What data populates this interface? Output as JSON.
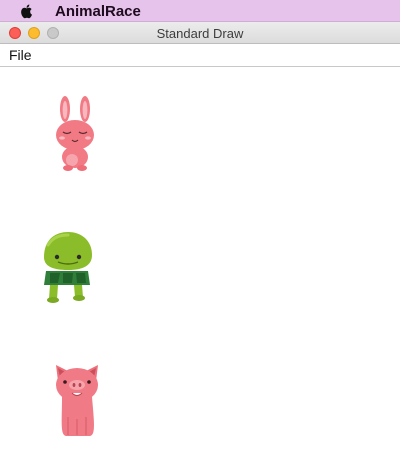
{
  "system_menubar": {
    "app_name": "AnimalRace",
    "icon": "apple-icon"
  },
  "window": {
    "title": "Standard Draw",
    "controls": [
      "close-icon",
      "minimize-icon",
      "zoom-icon"
    ]
  },
  "window_menu": {
    "items": [
      "File"
    ]
  },
  "canvas": {
    "sprites": [
      "bunny-icon",
      "turtle-icon",
      "pig-icon"
    ]
  },
  "colors": {
    "menubar_bg": "#e6c3ea",
    "bunny_pink": "#f27a84",
    "turtle_green": "#8bbd2a",
    "pig_pink": "#f07b86"
  }
}
